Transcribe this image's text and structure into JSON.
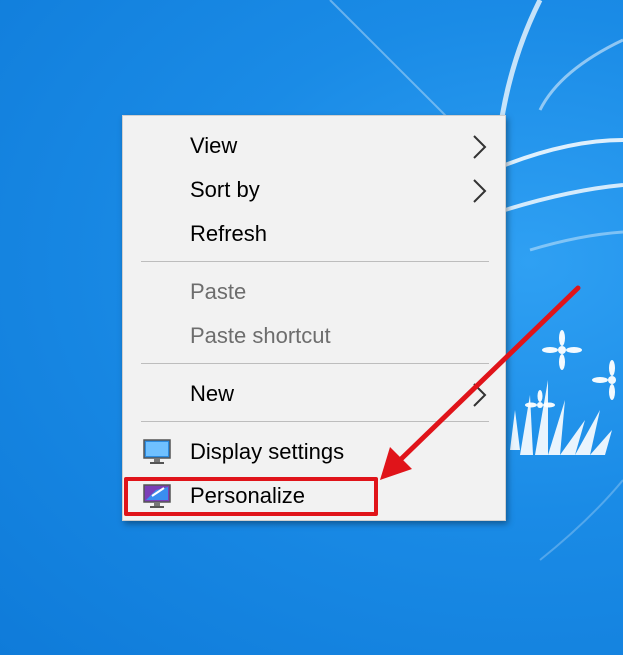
{
  "menu": {
    "items": [
      {
        "label": "View",
        "has_submenu": true,
        "enabled": true
      },
      {
        "label": "Sort by",
        "has_submenu": true,
        "enabled": true
      },
      {
        "label": "Refresh",
        "has_submenu": false,
        "enabled": true
      },
      {
        "label": "Paste",
        "has_submenu": false,
        "enabled": false
      },
      {
        "label": "Paste shortcut",
        "has_submenu": false,
        "enabled": false
      },
      {
        "label": "New",
        "has_submenu": true,
        "enabled": true
      },
      {
        "label": "Display settings",
        "icon": "display-settings-icon",
        "enabled": true
      },
      {
        "label": "Personalize",
        "icon": "personalize-icon",
        "enabled": true,
        "highlighted": true
      }
    ]
  },
  "colors": {
    "desktop": "#1a8be6",
    "menu_bg": "#f2f2f2",
    "annotation": "#e0141a",
    "disabled_text": "#6d6d6d"
  }
}
